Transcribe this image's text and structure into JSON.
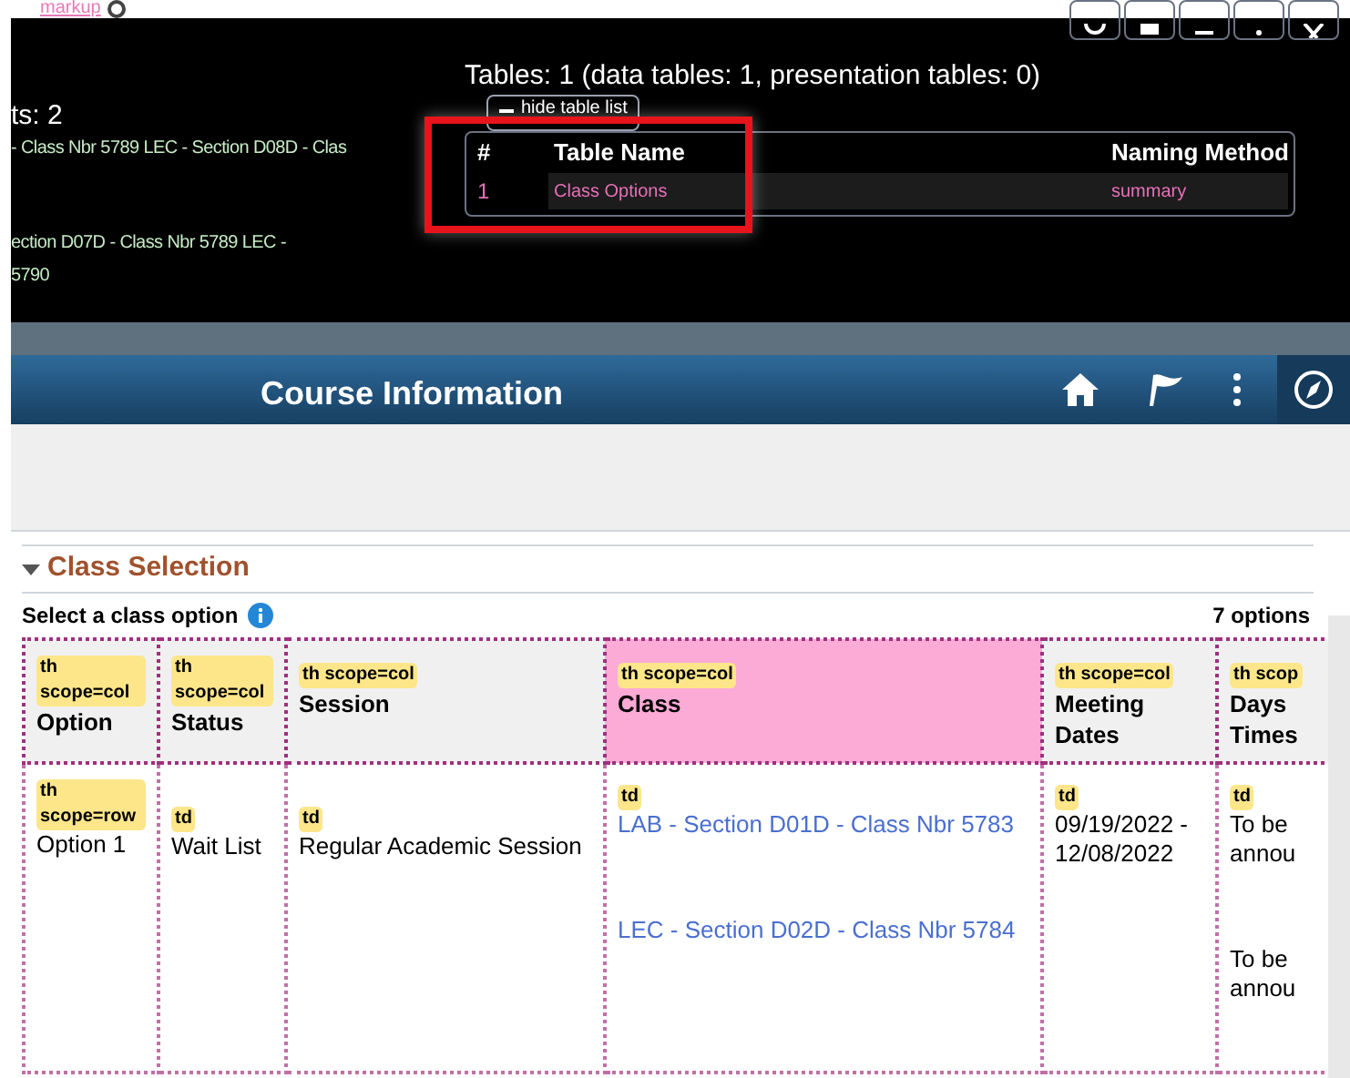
{
  "overlay": {
    "markup_link": "markup",
    "left_texts": [
      "ts: 2",
      "- Class Nbr 5789 LEC - Section D08D - Clas",
      "ection D07D - Class Nbr 5789 LEC -",
      "5790"
    ],
    "tables_summary": "Tables: 1 (data tables: 1, presentation tables: 0)",
    "toggle_button": "hide table list",
    "table_list": {
      "columns": [
        "#",
        "Table Name",
        "Naming Method"
      ],
      "rows": [
        {
          "number": "1",
          "name": "Class Options",
          "method": "summary"
        }
      ]
    }
  },
  "header": {
    "title": "Course Information"
  },
  "section": {
    "title": "Class Selection",
    "expanded": true,
    "prompt": "Select a class option",
    "count": "7 options"
  },
  "table": {
    "columns": [
      {
        "badge": "th scope=col",
        "label": "Option",
        "highlighted": false
      },
      {
        "badge": "th scope=col",
        "label": "Status",
        "highlighted": false
      },
      {
        "badge": "th scope=col",
        "label": "Session",
        "highlighted": false
      },
      {
        "badge": "th scope=col",
        "label": "Class",
        "highlighted": true
      },
      {
        "badge": "th scope=col",
        "label": "Meeting Dates",
        "highlighted": false
      },
      {
        "badge": "th scop",
        "label": "Days Times",
        "highlighted": false
      }
    ],
    "rows": [
      {
        "cells": [
          {
            "kind": "text",
            "badge": "th scope=row",
            "texts": [
              "Option 1"
            ]
          },
          {
            "kind": "text",
            "badge": "td",
            "texts": [
              "Wait List"
            ]
          },
          {
            "kind": "text",
            "badge": "td",
            "texts": [
              "Regular Academic Session"
            ]
          },
          {
            "kind": "links",
            "badge": "td",
            "texts": [
              "LAB - Section D01D - Class Nbr 5783",
              "LEC - Section D02D - Class Nbr 5784"
            ]
          },
          {
            "kind": "text",
            "badge": "td",
            "texts": [
              "09/19/2022 - 12/08/2022"
            ]
          },
          {
            "kind": "list",
            "badge": "td",
            "texts": [
              "To be annou",
              "To be annou"
            ]
          }
        ]
      }
    ]
  }
}
